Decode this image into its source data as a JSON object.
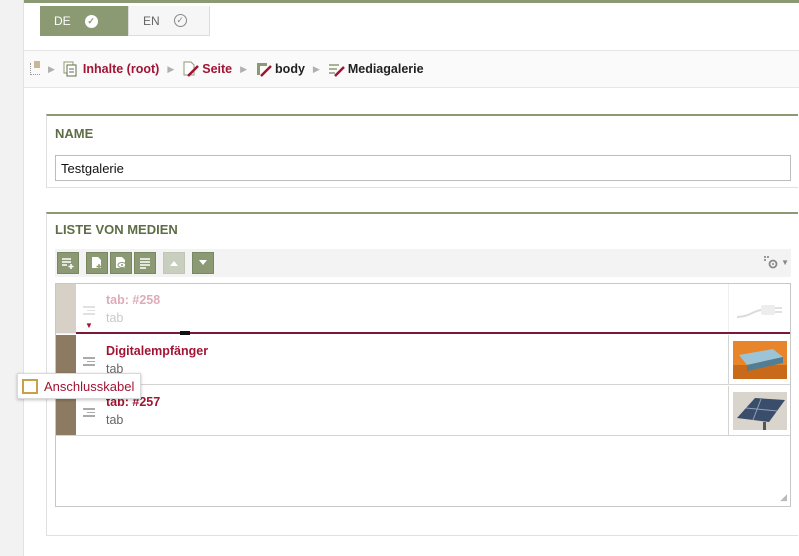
{
  "language_tabs": [
    {
      "label": "DE",
      "active": true
    },
    {
      "label": "EN",
      "active": false
    }
  ],
  "breadcrumb": [
    {
      "label": "Inhalte (root)",
      "icon": "documents-icon"
    },
    {
      "label": "Seite",
      "icon": "page-edit-icon"
    },
    {
      "label": "body",
      "icon": "container-edit-icon"
    },
    {
      "label": "Mediagalerie",
      "icon": "list-edit-icon"
    }
  ],
  "name_section": {
    "title": "NAME",
    "value": "Testgalerie"
  },
  "media_list": {
    "title": "LISTE VON MEDIEN",
    "toolbar": [
      "add-item-icon",
      "add-media-icon",
      "preview-icon",
      "edit-list-icon",
      "move-up-icon",
      "move-down-icon"
    ],
    "settings": "gear-settings-icon",
    "items": [
      {
        "title": "tab: #258",
        "subtitle": "tab",
        "thumbnail": "cable-plug-thumbnail",
        "state": "dragging"
      },
      {
        "title": "Digitalempfänger",
        "subtitle": "tab",
        "thumbnail": "receiver-thumbnail",
        "state": "normal"
      },
      {
        "title": "tab: #257",
        "subtitle": "tab",
        "thumbnail": "solar-panel-thumbnail",
        "state": "normal"
      }
    ]
  },
  "drag_ghost": {
    "label": "Anschlusskabel"
  },
  "colors": {
    "accent": "#8c9a74",
    "link": "#a11434",
    "handle": "#8c7a62"
  }
}
